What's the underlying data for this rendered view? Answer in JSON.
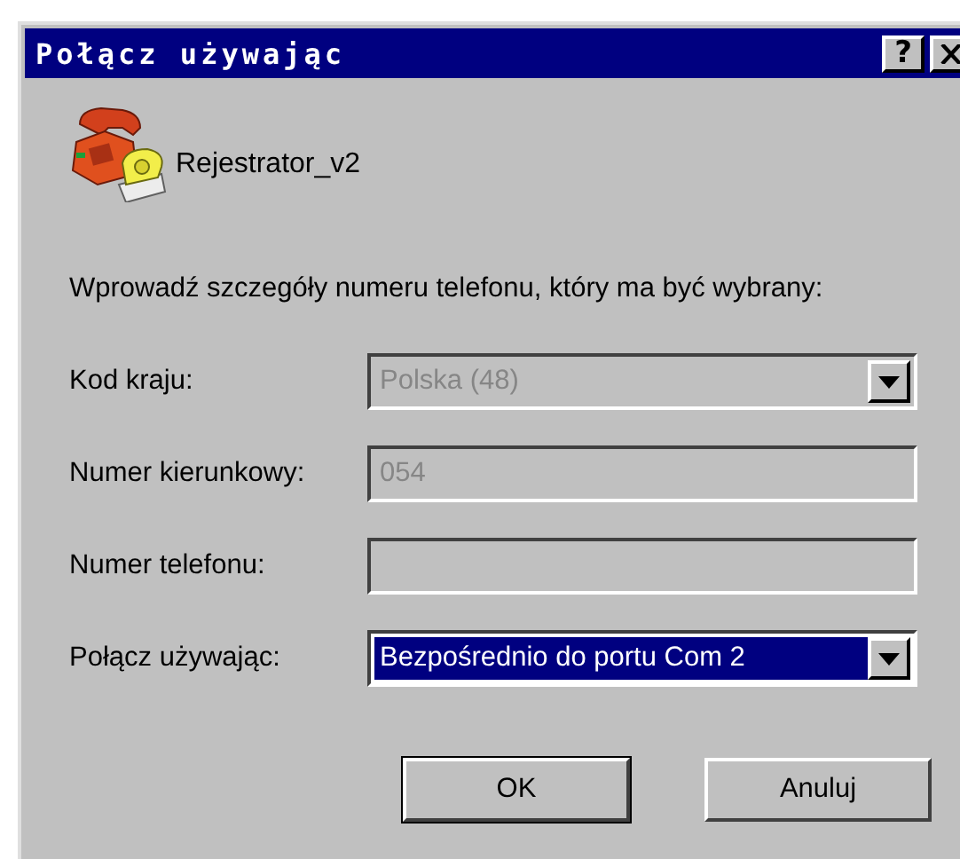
{
  "window": {
    "title": "Połącz używając",
    "title_buttons": [
      {
        "kind": "help",
        "label": "?"
      },
      {
        "kind": "close"
      }
    ]
  },
  "connection": {
    "name": "Rejestrator_v2"
  },
  "instruction": "Wprowadź szczegóły numeru telefonu, który ma być wybrany:",
  "fields": [
    {
      "label": "Kod kraju:",
      "kind": "combo",
      "value": "Polska (48)",
      "disabled": true,
      "selected": false
    },
    {
      "label": "Numer kierunkowy:",
      "kind": "text",
      "value": "054",
      "disabled": true,
      "selected": false
    },
    {
      "label": "Numer telefonu:",
      "kind": "text",
      "disabled": true,
      "selected": false
    },
    {
      "label": "Połącz używając:",
      "kind": "combo",
      "value": "Bezpośrednio do portu Com 2",
      "disabled": false,
      "selected": true
    }
  ],
  "buttons": [
    {
      "label": "OK",
      "default": true
    },
    {
      "label": "Anuluj",
      "default": false
    }
  ]
}
